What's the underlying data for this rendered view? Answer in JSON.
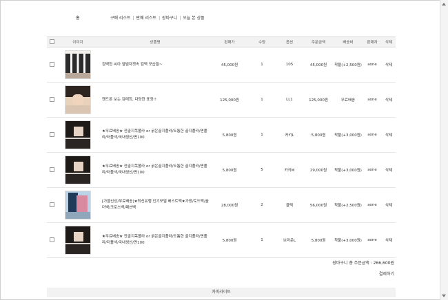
{
  "nav": {
    "home": "홈",
    "links": [
      "구매 리스트",
      "판매 리스트",
      "장바구니",
      "오늘 본 상품"
    ]
  },
  "table": {
    "headers": [
      "이미지",
      "상품명",
      "판매가",
      "수량",
      "옵션",
      "주문금액",
      "배송비",
      "판매자",
      "삭제"
    ],
    "rows": [
      {
        "name": "컴백한 씨아 엘범자켓속 컴백 모습들~",
        "price": "45,000원",
        "qty": "1",
        "option": "105",
        "total": "45,000원",
        "shipping": "착불(+2,500원)",
        "seller": "aone",
        "delete": "삭제"
      },
      {
        "name": "핸드폰 보는 김태희, 다양한 표정!!",
        "price": "125,000원",
        "qty": "1",
        "option": "LL1",
        "total": "125,000원",
        "shipping": "무료배송",
        "seller": "aone",
        "delete": "삭제"
      },
      {
        "name": "★무료배송★ 잔골지목폴라 or 굵은골지폴라/도톰한 골지폴라/면폴라/터틀넥/국내생산/면100",
        "price": "5,800원",
        "qty": "1",
        "option": "카키L",
        "total": "5,800원",
        "shipping": "착불(+3,000원)",
        "seller": "aone",
        "delete": "삭제"
      },
      {
        "name": "★무료배송★ 잔골지목폴라 or 굵은골지폴라/도톰한 골지폴라/면폴라/터틀넥/국내생산/면100",
        "price": "5,800원",
        "qty": "5",
        "option": "카키M",
        "total": "29,000원",
        "shipping": "착불(+3,000원)",
        "seller": "aone",
        "delete": "삭제"
      },
      {
        "name": "[가을신상/무료배송]★최신유행 인기모델 베스트백★가방/토드백/숄더백/크로스백/패션백",
        "price": "28,000원",
        "qty": "2",
        "option": "블랙",
        "total": "56,000원",
        "shipping": "착불(+2,500원)",
        "seller": "aone",
        "delete": "삭제"
      },
      {
        "name": "★무료배송★ 잔골지목폴라 or 굵은골지폴라/도톰한 골지폴라/면폴라/터틀넥/국내생산/면100",
        "price": "5,800원",
        "qty": "1",
        "option": "브라운L",
        "total": "5,800원",
        "shipping": "착불(+3,000원)",
        "seller": "aone",
        "delete": "삭제"
      }
    ]
  },
  "summary": {
    "total_text": "장바구니 총 주문금액 : 266,600원",
    "pay_label": "결제하기"
  },
  "footer": {
    "text": "카피라이트"
  }
}
